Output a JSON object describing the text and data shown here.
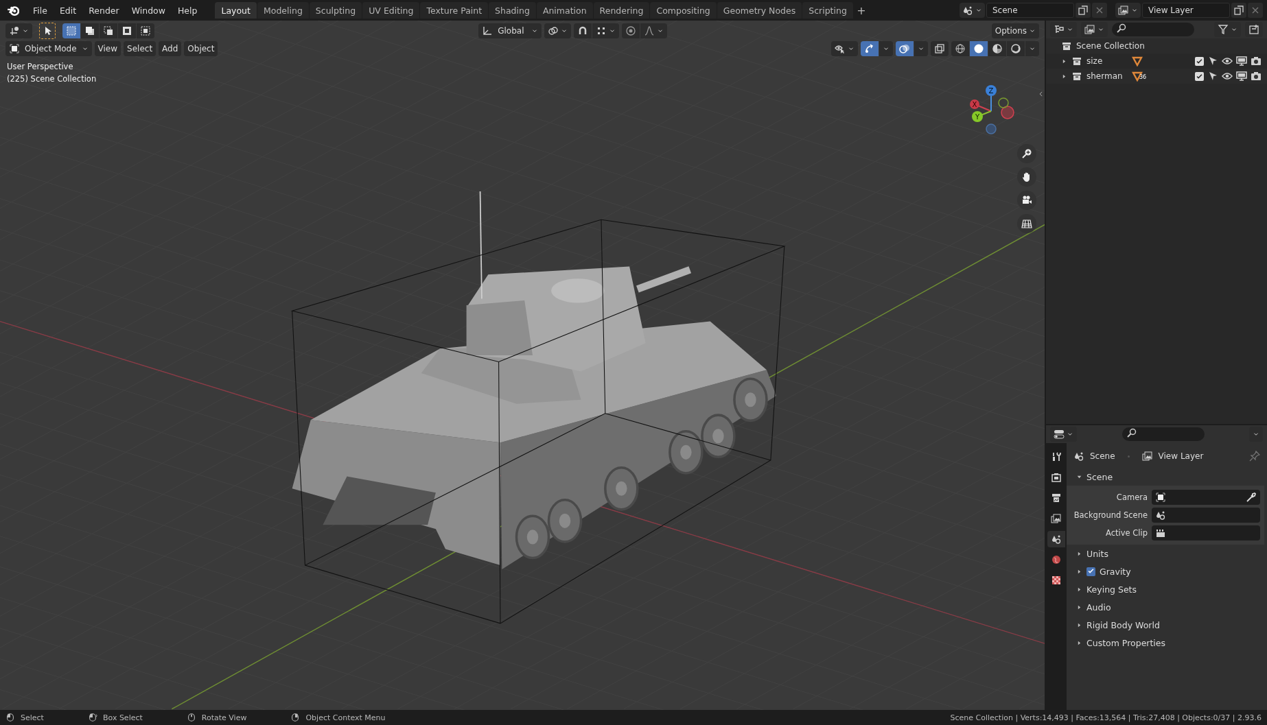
{
  "menu_bar": {
    "menus": [
      "File",
      "Edit",
      "Render",
      "Window",
      "Help"
    ],
    "workspaces": [
      {
        "label": "Layout",
        "selected": true
      },
      {
        "label": "Modeling",
        "selected": false
      },
      {
        "label": "Sculpting",
        "selected": false
      },
      {
        "label": "UV Editing",
        "selected": false
      },
      {
        "label": "Texture Paint",
        "selected": false
      },
      {
        "label": "Shading",
        "selected": false
      },
      {
        "label": "Animation",
        "selected": false
      },
      {
        "label": "Rendering",
        "selected": false
      },
      {
        "label": "Compositing",
        "selected": false
      },
      {
        "label": "Geometry Nodes",
        "selected": false
      },
      {
        "label": "Scripting",
        "selected": false
      }
    ],
    "add_button": "+",
    "scene": "Scene",
    "view_layer": "View Layer"
  },
  "viewport": {
    "select_modes": [
      {
        "selected": true
      },
      {
        "selected": false
      },
      {
        "selected": false
      },
      {
        "selected": false
      },
      {
        "selected": false
      }
    ],
    "orientation": "Global",
    "options": "Options",
    "mode": "Object Mode",
    "menus": [
      "View",
      "Select",
      "Add",
      "Object"
    ],
    "gizmos": {
      "on": true
    },
    "overlays": {
      "on": true
    },
    "shading_modes": [
      {
        "selected": false
      },
      {
        "selected": true
      },
      {
        "selected": false
      },
      {
        "selected": false
      }
    ],
    "overlay_text": [
      "User Perspective",
      "(225) Scene Collection"
    ],
    "gizmo_labels": {
      "x": "X",
      "y": "Y",
      "z": "Z"
    }
  },
  "outliner": {
    "root": "Scene Collection",
    "items": [
      {
        "name": "size",
        "expanded": false,
        "checked": true
      },
      {
        "name": "sherman",
        "expanded": false,
        "checked": true,
        "badge": "36"
      }
    ]
  },
  "properties": {
    "tabs": [
      {
        "kind": "tool",
        "selected": false
      },
      {
        "kind": "render",
        "selected": false
      },
      {
        "kind": "output",
        "selected": false
      },
      {
        "kind": "view_layer",
        "selected": false
      },
      {
        "kind": "scene",
        "selected": true
      },
      {
        "kind": "world",
        "selected": false
      },
      {
        "kind": "texture",
        "selected": false
      }
    ],
    "breadcrumb": [
      "Scene",
      "View Layer"
    ],
    "panel": {
      "title": "Scene",
      "expanded": true
    },
    "fields": [
      {
        "label": "Camera",
        "kind": "camera"
      },
      {
        "label": "Background Scene",
        "kind": "scene"
      },
      {
        "label": "Active Clip",
        "kind": "clip"
      }
    ],
    "subpanels": [
      {
        "label": "Units",
        "kind": "plain"
      },
      {
        "label": "Gravity",
        "kind": "checkbox",
        "checked": true
      },
      {
        "label": "Keying Sets",
        "kind": "plain"
      },
      {
        "label": "Audio",
        "kind": "plain"
      },
      {
        "label": "Rigid Body World",
        "kind": "plain"
      },
      {
        "label": "Custom Properties",
        "kind": "plain"
      }
    ]
  },
  "status_bar": {
    "hints": [
      {
        "label": "Select",
        "kind": "left"
      },
      {
        "label": "Box Select",
        "kind": "drag"
      },
      {
        "label": "Rotate View",
        "kind": "middle"
      },
      {
        "label": "Object Context Menu",
        "kind": "right"
      }
    ],
    "stats": "Scene Collection | Verts:14,493 | Faces:13,564 | Tris:27,408 | Objects:0/37 | 2.93.6"
  }
}
